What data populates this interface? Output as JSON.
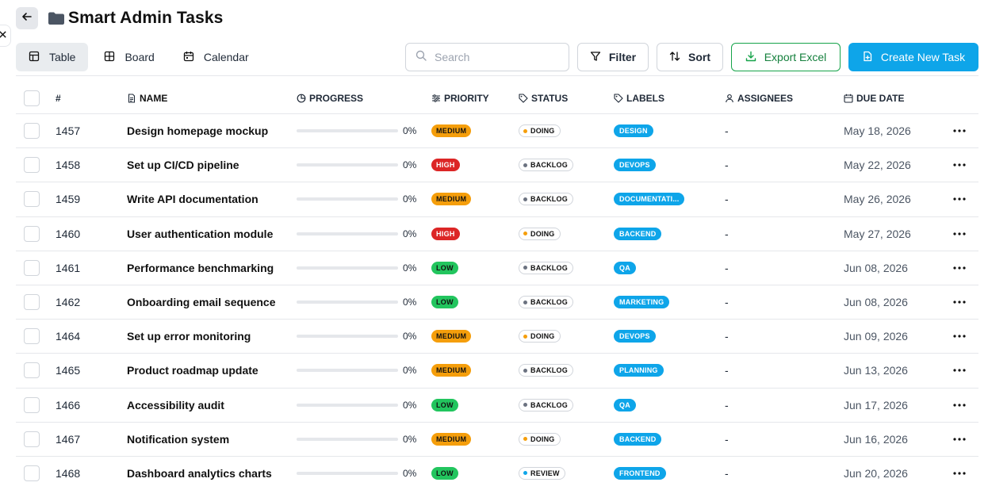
{
  "header": {
    "title": "Smart Admin Tasks"
  },
  "views": [
    {
      "label": "Table",
      "icon": "table-icon",
      "active": true
    },
    {
      "label": "Board",
      "icon": "board-icon",
      "active": false
    },
    {
      "label": "Calendar",
      "icon": "calendar-icon",
      "active": false
    }
  ],
  "toolbar": {
    "search_placeholder": "Search",
    "filter_label": "Filter",
    "sort_label": "Sort",
    "export_label": "Export Excel",
    "create_label": "Create New Task"
  },
  "columns": {
    "id": "#",
    "name": "NAME",
    "progress": "PROGRESS",
    "priority": "PRIORITY",
    "status": "STATUS",
    "labels": "LABELS",
    "assignees": "ASSIGNEES",
    "due": "DUE DATE"
  },
  "colors": {
    "accent": "#0ea5e9",
    "export_green": "#16a34a",
    "priority_medium": "#f59e0b",
    "priority_high": "#dc2626",
    "priority_low": "#22c55e"
  },
  "tasks": [
    {
      "id": "1457",
      "name": "Design homepage mockup",
      "progress": 0,
      "progress_text": "0%",
      "priority": "MEDIUM",
      "status": "DOING",
      "label": "DESIGN",
      "assignees": "-",
      "due": "May 18, 2026"
    },
    {
      "id": "1458",
      "name": "Set up CI/CD pipeline",
      "progress": 0,
      "progress_text": "0%",
      "priority": "HIGH",
      "status": "BACKLOG",
      "label": "DEVOPS",
      "assignees": "-",
      "due": "May 22, 2026"
    },
    {
      "id": "1459",
      "name": "Write API documentation",
      "progress": 0,
      "progress_text": "0%",
      "priority": "MEDIUM",
      "status": "BACKLOG",
      "label": "DOCUMENTATI...",
      "assignees": "-",
      "due": "May 26, 2026"
    },
    {
      "id": "1460",
      "name": "User authentication module",
      "progress": 0,
      "progress_text": "0%",
      "priority": "HIGH",
      "status": "DOING",
      "label": "BACKEND",
      "assignees": "-",
      "due": "May 27, 2026"
    },
    {
      "id": "1461",
      "name": "Performance benchmarking",
      "progress": 0,
      "progress_text": "0%",
      "priority": "LOW",
      "status": "BACKLOG",
      "label": "QA",
      "assignees": "-",
      "due": "Jun 08, 2026"
    },
    {
      "id": "1462",
      "name": "Onboarding email sequence",
      "progress": 0,
      "progress_text": "0%",
      "priority": "LOW",
      "status": "BACKLOG",
      "label": "MARKETING",
      "assignees": "-",
      "due": "Jun 08, 2026"
    },
    {
      "id": "1464",
      "name": "Set up error monitoring",
      "progress": 0,
      "progress_text": "0%",
      "priority": "MEDIUM",
      "status": "DOING",
      "label": "DEVOPS",
      "assignees": "-",
      "due": "Jun 09, 2026"
    },
    {
      "id": "1465",
      "name": "Product roadmap update",
      "progress": 0,
      "progress_text": "0%",
      "priority": "MEDIUM",
      "status": "BACKLOG",
      "label": "PLANNING",
      "assignees": "-",
      "due": "Jun 13, 2026"
    },
    {
      "id": "1466",
      "name": "Accessibility audit",
      "progress": 0,
      "progress_text": "0%",
      "priority": "LOW",
      "status": "BACKLOG",
      "label": "QA",
      "assignees": "-",
      "due": "Jun 17, 2026"
    },
    {
      "id": "1467",
      "name": "Notification system",
      "progress": 0,
      "progress_text": "0%",
      "priority": "MEDIUM",
      "status": "DOING",
      "label": "BACKEND",
      "assignees": "-",
      "due": "Jun 16, 2026"
    },
    {
      "id": "1468",
      "name": "Dashboard analytics charts",
      "progress": 0,
      "progress_text": "0%",
      "priority": "LOW",
      "status": "REVIEW",
      "label": "FRONTEND",
      "assignees": "-",
      "due": "Jun 20, 2026"
    }
  ]
}
